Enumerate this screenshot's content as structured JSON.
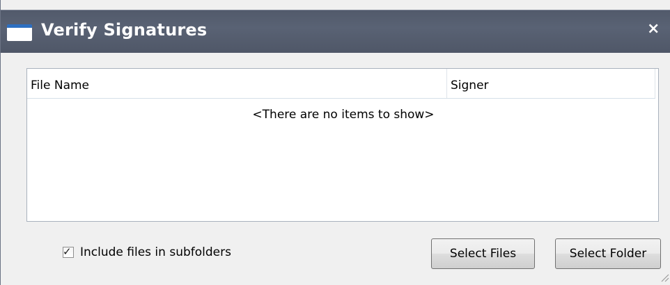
{
  "window": {
    "title": "Verify Signatures",
    "close_symbol": "×",
    "accent_color": "#2d6fc1",
    "titlebar_color": "#555d6e"
  },
  "table": {
    "columns": [
      "File Name",
      "Signer"
    ],
    "rows": [],
    "empty_message": "<There are no items to show>"
  },
  "options": {
    "include_subfolders": {
      "label": "Include files in subfolders",
      "checked": true,
      "check_symbol": "✓"
    }
  },
  "buttons": {
    "select_files": "Select Files",
    "select_folder": "Select Folder"
  },
  "icons": {
    "title": "window-icon",
    "close": "close-icon",
    "resize": "resize-grip-icon"
  }
}
